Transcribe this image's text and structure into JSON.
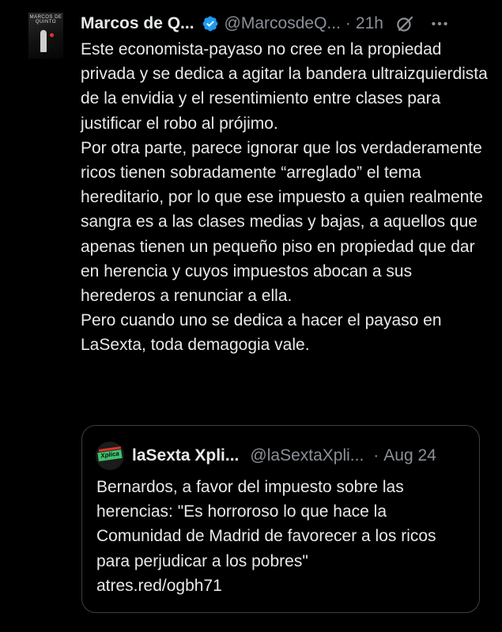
{
  "tweet": {
    "author": {
      "display_name": "Marcos de Q...",
      "handle": "@MarcosdeQ...",
      "verified": true,
      "avatar_text": "MARCOS DE QUINTO"
    },
    "separator": "·",
    "time": "21h",
    "text_lines": [
      "Este economista-payaso no cree en la propiedad privada y se dedica a agitar la bandera ultraizquierdista de la envidia y el resentimiento entre clases para justificar el robo al prójimo.",
      "Por otra parte, parece ignorar que los verdaderamente ricos tienen sobradamente “arreglado” el tema hereditario, por lo que ese impuesto a quien realmente sangra es a las clases medias y bajas, a aquellos que apenas tienen un pequeño piso en propiedad que dar en herencia y cuyos impuestos abocan a sus herederos a renunciar a ella.",
      "Pero cuando uno se dedica a hacer el payaso en LaSexta, toda demagogia vale."
    ],
    "icons": {
      "verified": "verified-badge-icon",
      "grok": "grok-icon",
      "more": "more-options-icon"
    },
    "colors": {
      "background": "#000000",
      "text": "#e7e9ea",
      "secondary": "#8b9097",
      "verified": "#1d9bf0",
      "border": "#3b4045"
    }
  },
  "quoted_tweet": {
    "display_name": "laSexta Xpli...",
    "handle": "@laSextaXpli...",
    "separator": "·",
    "date": "Aug 24",
    "avatar_text": "Xplica",
    "text_lines": [
      "Bernardos, a favor del impuesto sobre las herencias: \"Es horroroso lo que hace la Comunidad de Madrid de favorecer a los ricos para perjudicar a los pobres\"",
      "atres.red/ogbh71"
    ]
  }
}
